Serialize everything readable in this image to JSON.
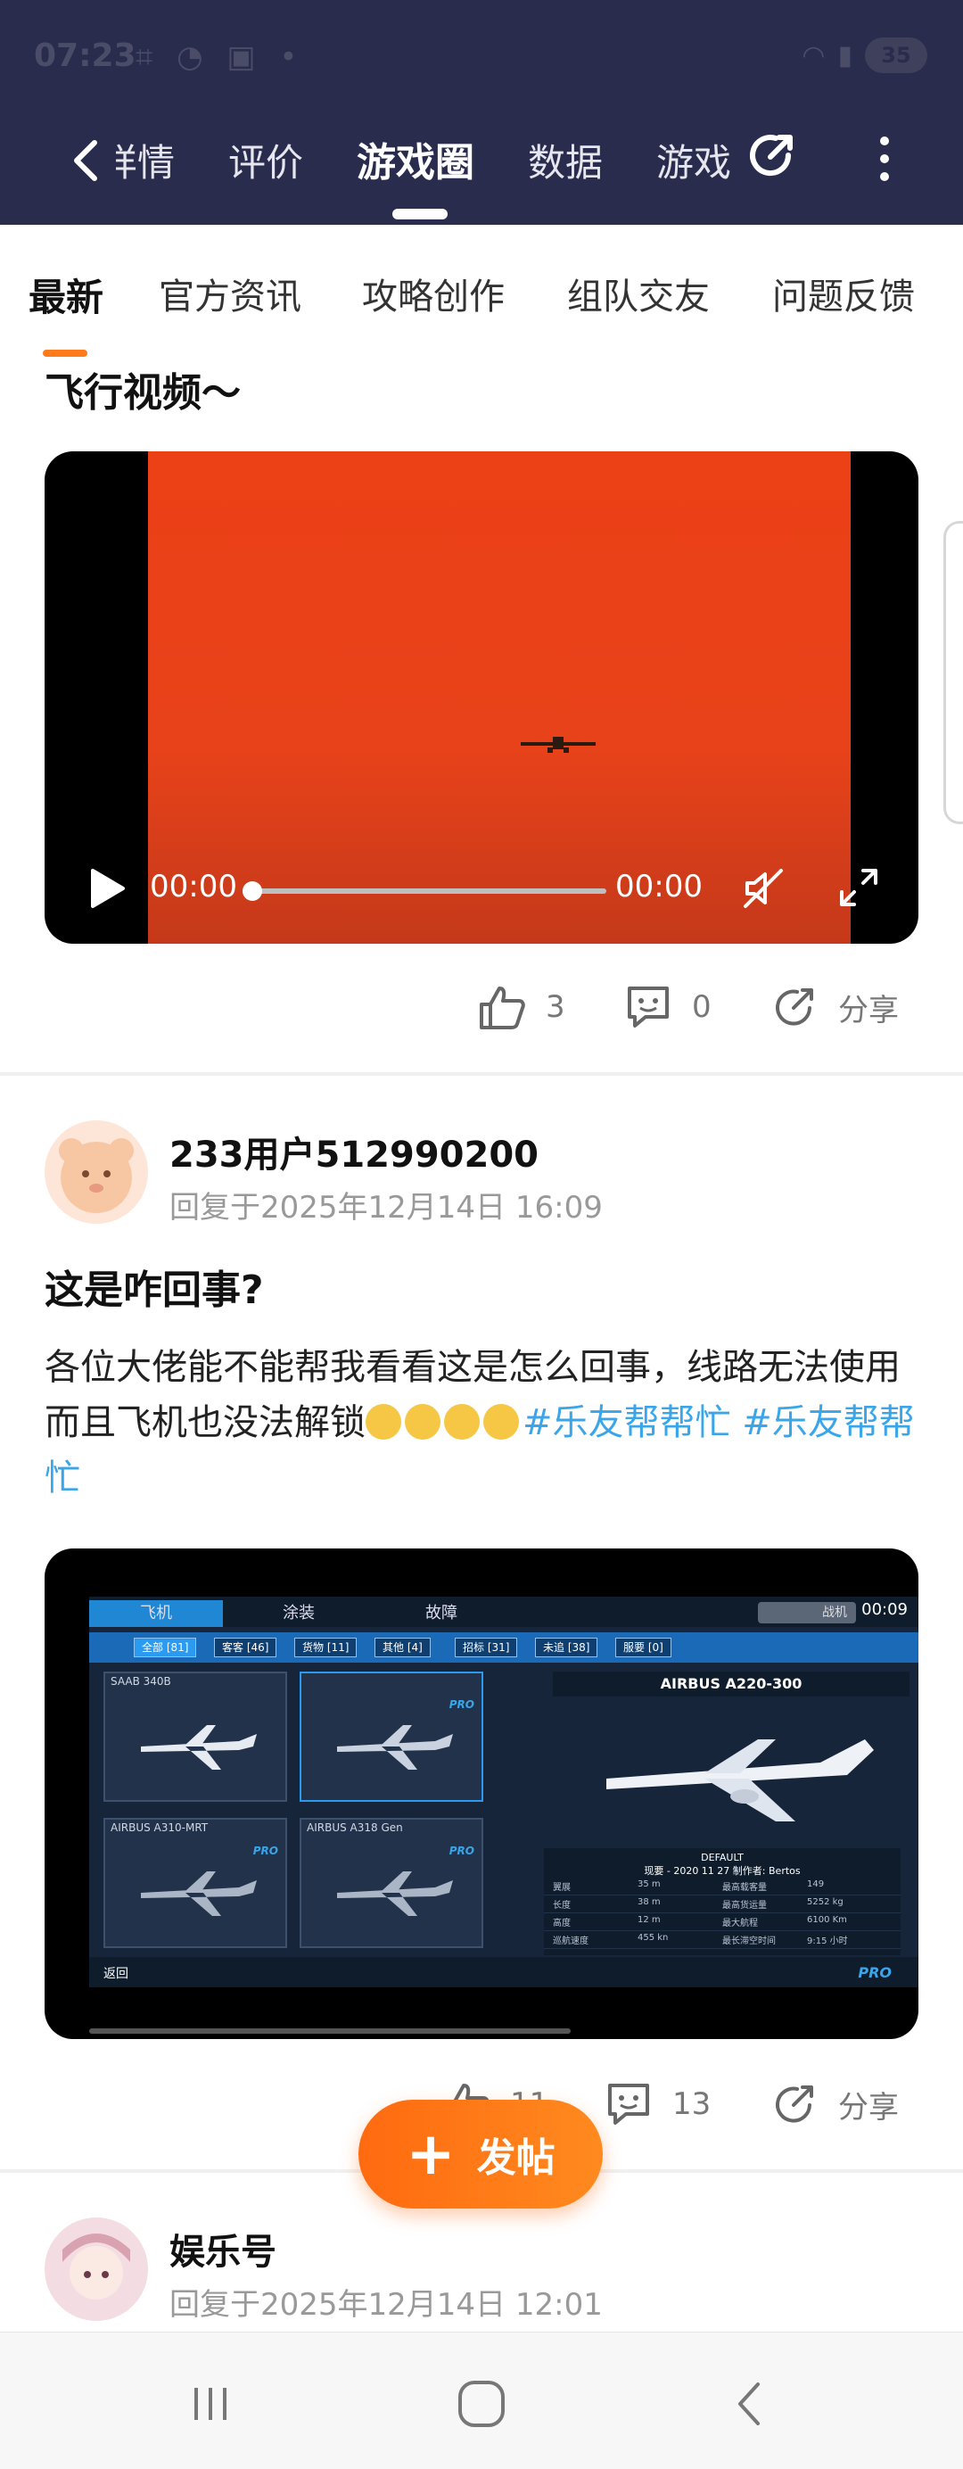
{
  "status_bar": {
    "time": "07:23",
    "battery": "35"
  },
  "top_nav": {
    "tabs": [
      "详情",
      "评价",
      "游戏圈",
      "数据",
      "游戏"
    ],
    "active_tab": "游戏圈"
  },
  "sub_tabs": {
    "items": [
      "最新",
      "官方资讯",
      "攻略创作",
      "组队交友",
      "问题反馈"
    ],
    "active": "最新"
  },
  "post1": {
    "title_partial": "飞行视频～",
    "video": {
      "current_time": "00:00",
      "total_time": "00:00",
      "progress": 0
    },
    "likes": "3",
    "comments": "0",
    "share_label": "分享"
  },
  "post2": {
    "username": "233用户512990200",
    "reply_time": "回复于2025年12月14日 16:09",
    "title": "这是咋回事?",
    "body_text": "各位大佬能不能帮我看看这是怎么回事，线路无法使用而且飞机也没法解锁",
    "emoji_count": 4,
    "tags": [
      "#乐友帮帮忙",
      "#乐友帮帮忙"
    ],
    "screenshot": {
      "tabs": [
        "飞机",
        "涂装",
        "故障"
      ],
      "clock": "00:09",
      "search": "战机",
      "filters": [
        "全部 [81]",
        "客客 [46]",
        "货物 [11]",
        "其他 [4]",
        "招标 [31]",
        "未追 [38]",
        "服要 [0]"
      ],
      "cards": [
        "SAAB 340B",
        "",
        "AIRBUS A310-MRT",
        "AIRBUS A318 Gen"
      ],
      "pro_badge": "PRO",
      "detail_title": "AIRBUS A220-300",
      "info_head": "DEFAULT",
      "info_sub": "现要 - 2020 11 27 制作者: Bertos",
      "info_rows": [
        [
          "翼展",
          "35 m",
          "最高载客量",
          "149"
        ],
        [
          "长度",
          "38 m",
          "最高货运量",
          "5252 kg"
        ],
        [
          "高度",
          "12 m",
          "最大航程",
          "6100 Km"
        ],
        [
          "巡航速度",
          "455 kn",
          "最长滞空时间",
          "9:15 小时"
        ]
      ],
      "back_label": "返回"
    },
    "likes": "11",
    "comments": "13",
    "share_label": "分享"
  },
  "post3": {
    "username": "娱乐号",
    "reply_time": "回复于2025年12月14日 12:01"
  },
  "fab": {
    "label": "发帖"
  },
  "colors": {
    "header_bg": "#2a2c4e",
    "accent_orange": "#ff7a1a",
    "tag_blue": "#3aa5e8",
    "video_orange": "#ec4016"
  }
}
